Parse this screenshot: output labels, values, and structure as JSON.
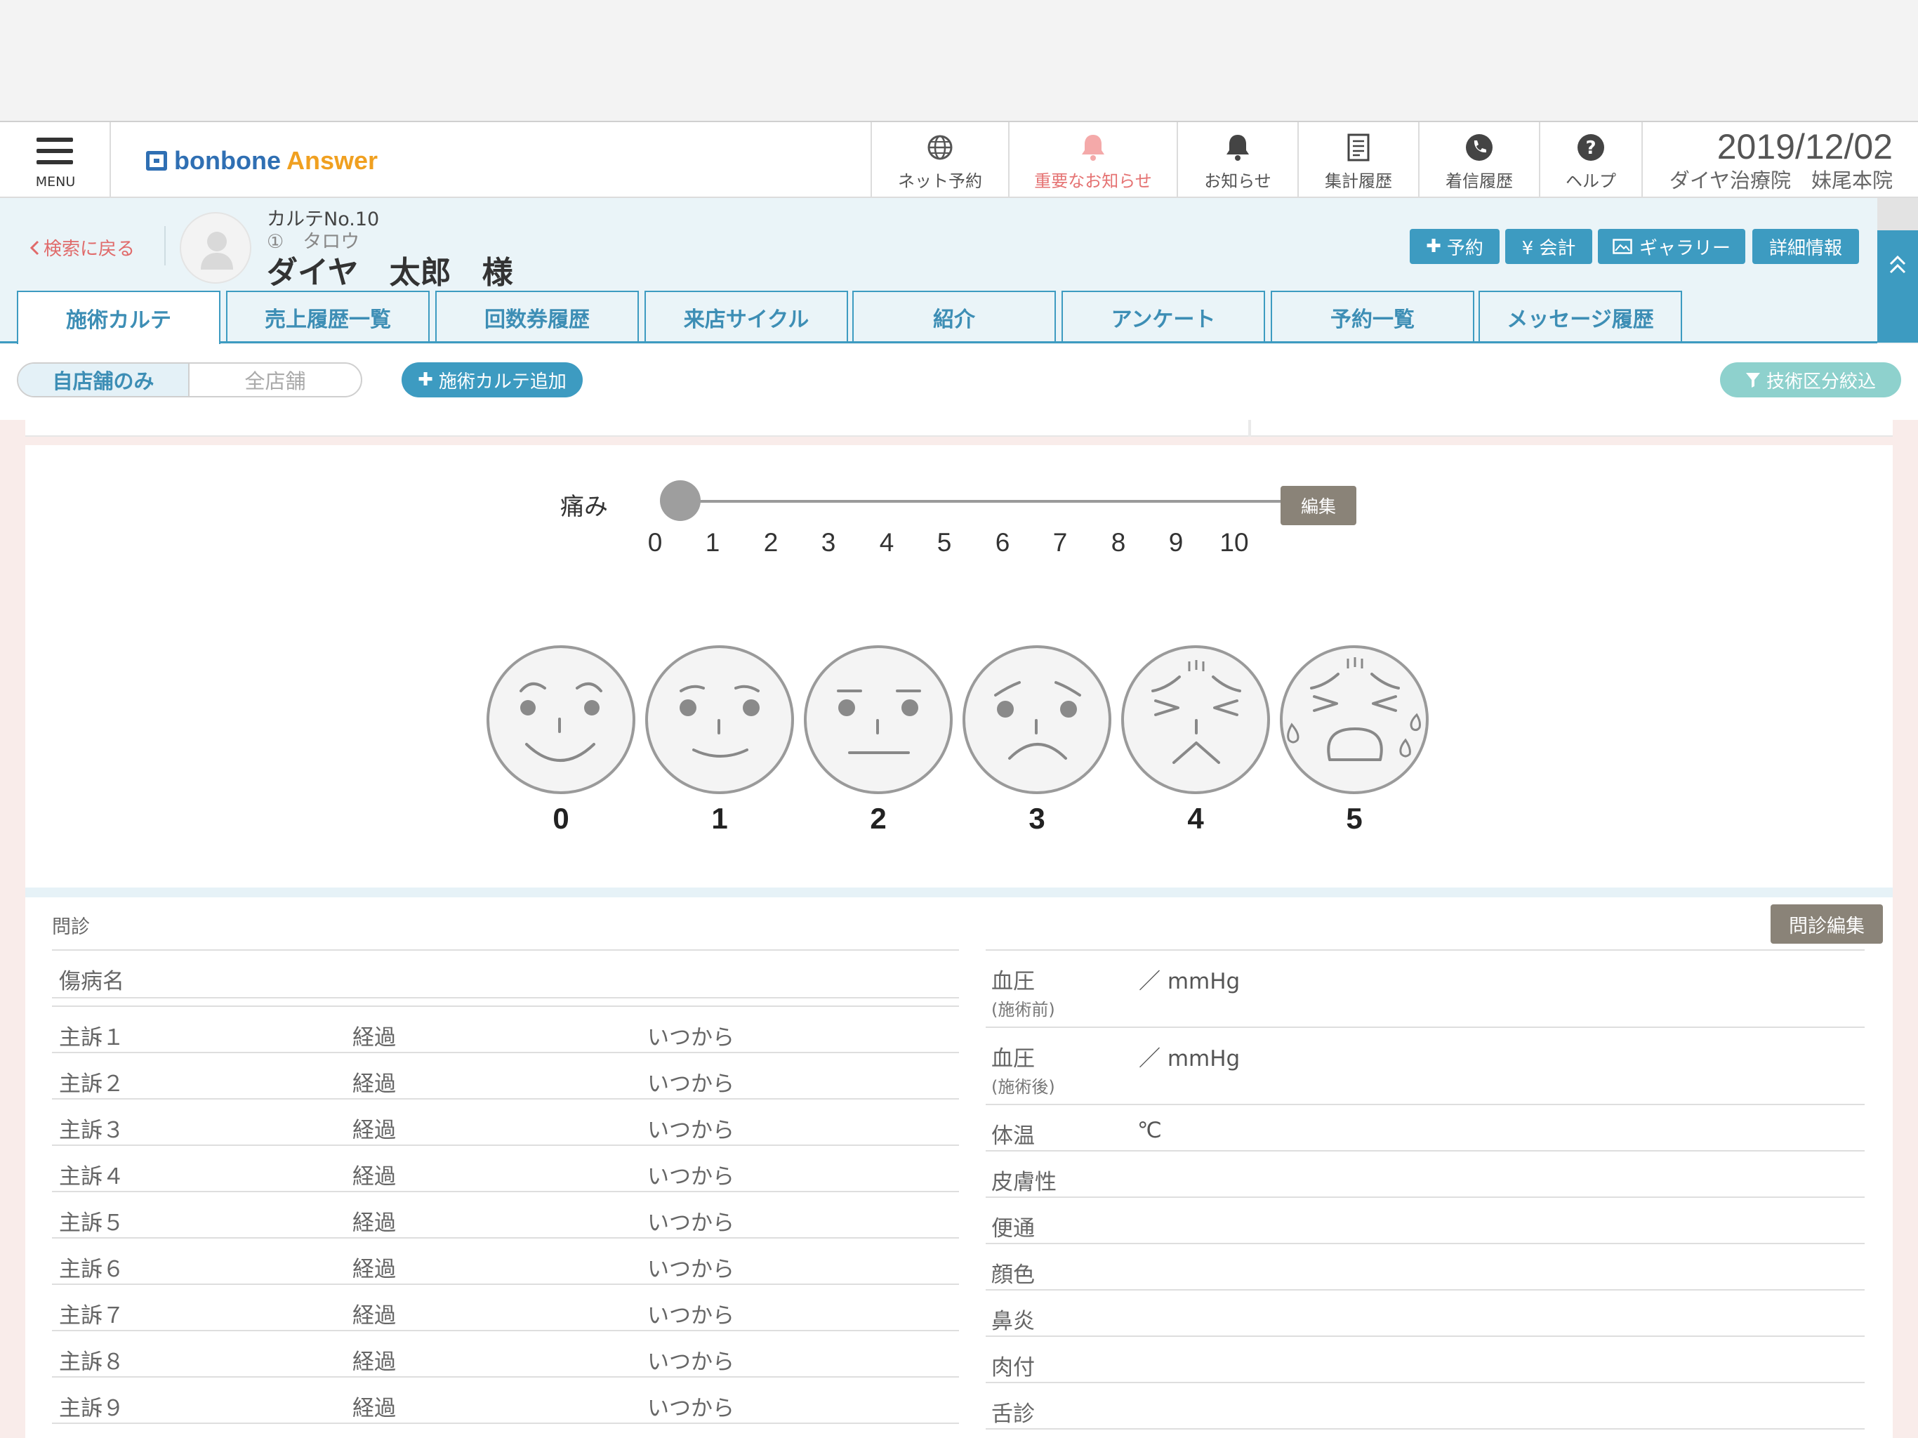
{
  "header": {
    "menu_label": "MENU",
    "logo_part1": "bonbone",
    "logo_part2": "Answer",
    "nav": [
      {
        "label": "ネット予約",
        "icon": "globe-icon"
      },
      {
        "label": "重要なお知らせ",
        "icon": "bell-alert-icon",
        "color": "#e57373"
      },
      {
        "label": "お知らせ",
        "icon": "bell-icon"
      },
      {
        "label": "集計履歴",
        "icon": "document-icon"
      },
      {
        "label": "着信履歴",
        "icon": "phone-icon"
      },
      {
        "label": "ヘルプ",
        "icon": "help-icon"
      }
    ],
    "date": "2019/12/02",
    "clinic": "ダイヤ治療院　妹尾本院"
  },
  "patient": {
    "back_label": "検索に戻る",
    "karte_no": "カルテNo.10",
    "kana": "①　タロウ",
    "name": "ダイヤ　太郎　様",
    "buttons": {
      "reserve": "予約",
      "accounting": "¥ 会計",
      "gallery": "ギャラリー",
      "details": "詳細情報"
    }
  },
  "tabs": [
    "施術カルテ",
    "売上履歴一覧",
    "回数券履歴",
    "来店サイクル",
    "紹介",
    "アンケート",
    "予約一覧",
    "メッセージ履歴"
  ],
  "filter": {
    "own_store": "自店舗のみ",
    "all_stores": "全店舗",
    "add_karte": "施術カルテ追加",
    "tech_filter": "技術区分絞込"
  },
  "pain": {
    "label": "痛み",
    "value": 0,
    "min": 0,
    "max": 10,
    "ticks": [
      "0",
      "1",
      "2",
      "3",
      "4",
      "5",
      "6",
      "7",
      "8",
      "9",
      "10"
    ],
    "edit_label": "編集",
    "faces": [
      "0",
      "1",
      "2",
      "3",
      "4",
      "5"
    ]
  },
  "monshin": {
    "title": "問診",
    "edit_label": "問診編集",
    "injury_label": "傷病名",
    "complaints": [
      {
        "label": "主訴１",
        "progress": "経過",
        "since": "いつから"
      },
      {
        "label": "主訴２",
        "progress": "経過",
        "since": "いつから"
      },
      {
        "label": "主訴３",
        "progress": "経過",
        "since": "いつから"
      },
      {
        "label": "主訴４",
        "progress": "経過",
        "since": "いつから"
      },
      {
        "label": "主訴５",
        "progress": "経過",
        "since": "いつから"
      },
      {
        "label": "主訴６",
        "progress": "経過",
        "since": "いつから"
      },
      {
        "label": "主訴７",
        "progress": "経過",
        "since": "いつから"
      },
      {
        "label": "主訴８",
        "progress": "経過",
        "since": "いつから"
      },
      {
        "label": "主訴９",
        "progress": "経過",
        "since": "いつから"
      }
    ],
    "vitals": {
      "bp_before_label": "血圧",
      "bp_before_sub": "(施術前)",
      "bp_before_value": "／ mmHg",
      "bp_after_label": "血圧",
      "bp_after_sub": "(施術後)",
      "bp_after_value": "／ mmHg",
      "temp_label": "体温",
      "temp_value": "℃",
      "others": [
        "皮膚性",
        "便通",
        "顔色",
        "鼻炎",
        "肉付",
        "舌診"
      ]
    }
  },
  "colors": {
    "accent": "#3d9bc1",
    "alert": "#e57373",
    "edit_button": "#8a8378",
    "filter_button": "#8ed1cd"
  }
}
